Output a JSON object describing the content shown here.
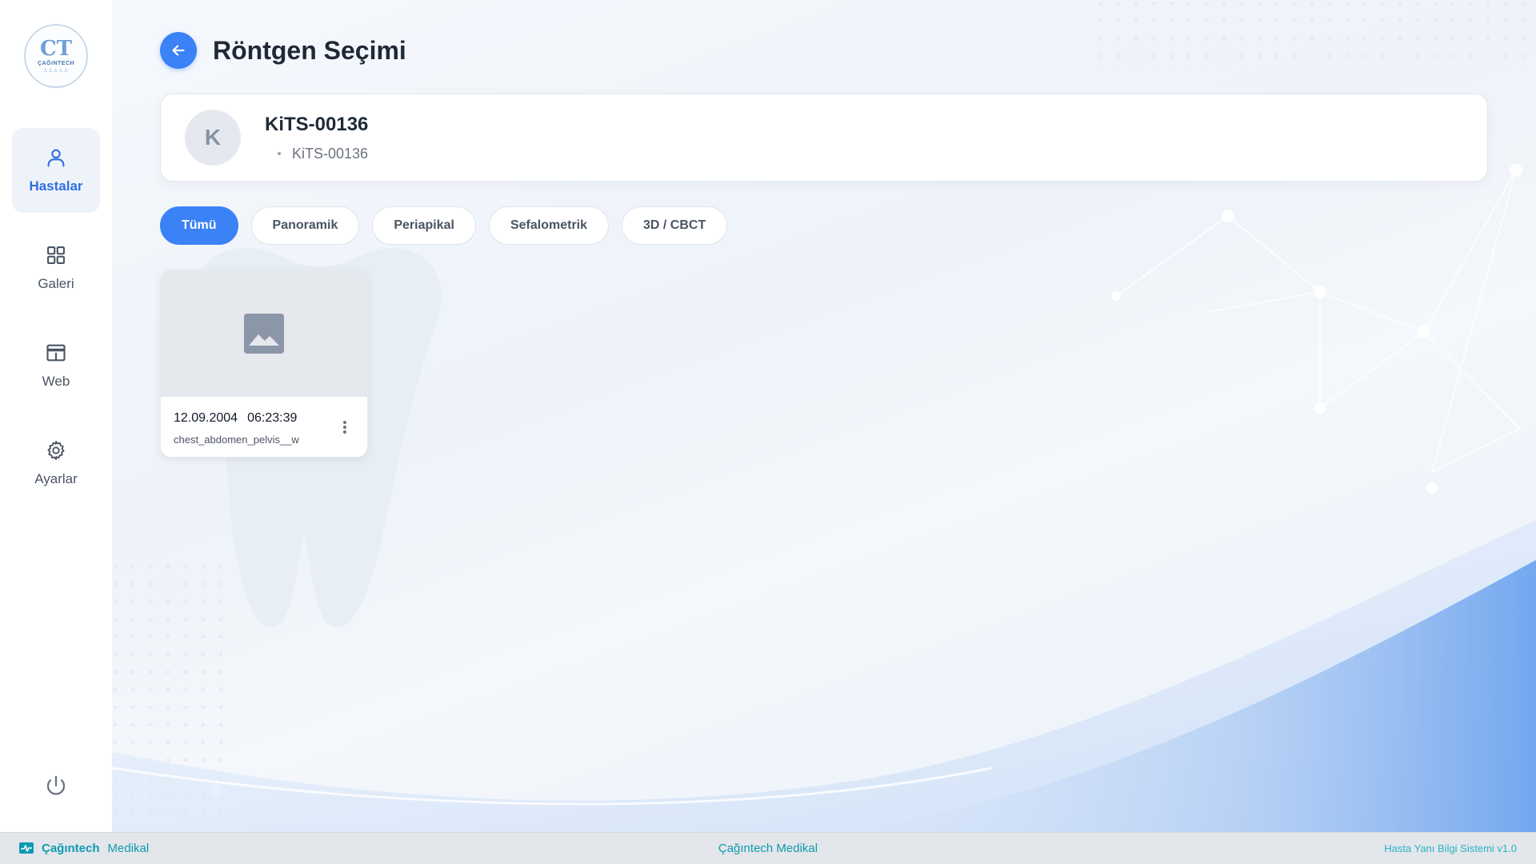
{
  "sidebar": {
    "logo_text": "ÇAĞINTECH",
    "logo_mark": "CT",
    "items": [
      {
        "label": "Hastalar",
        "icon": "user-icon",
        "active": true
      },
      {
        "label": "Galeri",
        "icon": "grid-icon",
        "active": false
      },
      {
        "label": "Web",
        "icon": "browser-window-icon",
        "active": false
      },
      {
        "label": "Ayarlar",
        "icon": "gear-icon",
        "active": false
      }
    ],
    "power_icon": "power-icon"
  },
  "header": {
    "title": "Röntgen Seçimi",
    "back_icon": "arrow-left-icon"
  },
  "patient": {
    "avatar_initial": "K",
    "name": "KiTS-00136",
    "id": "KiTS-00136"
  },
  "filters": [
    {
      "label": "Tümü",
      "active": true
    },
    {
      "label": "Panoramik",
      "active": false
    },
    {
      "label": "Periapikal",
      "active": false
    },
    {
      "label": "Sefalometrik",
      "active": false
    },
    {
      "label": "3D / CBCT",
      "active": false
    }
  ],
  "xrays": [
    {
      "date": "12.09.2004",
      "time": "06:23:39",
      "filename": "chest_abdomen_pelvis__w",
      "thumb_icon": "image-placeholder-icon"
    }
  ],
  "footer": {
    "left_brand": "Çağıntech",
    "left_brand_suffix": "Medikal",
    "center": "Çağıntech Medikal",
    "right": "Hasta Yanı Bilgi Sistemi v1.0"
  },
  "colors": {
    "accent": "#3b82f6",
    "footer_text": "#0e9bb0",
    "active_nav_bg": "#eef3fa"
  }
}
